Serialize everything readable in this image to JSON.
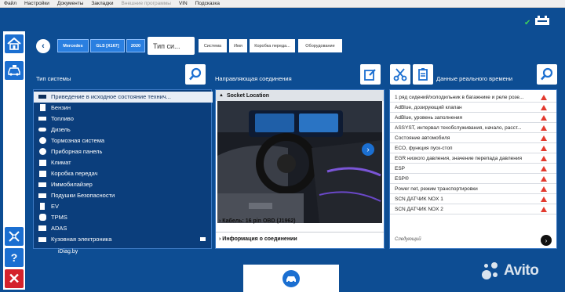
{
  "menu": {
    "items": [
      "Файл",
      "Настройки",
      "Документы",
      "Закладки",
      "Внешние программы",
      "VIN",
      "Подсказка"
    ],
    "disabled_index": 4
  },
  "breadcrumb": {
    "back_label": "‹",
    "crumbs": [
      "Mercedes",
      "GLS [X167]",
      "2020"
    ],
    "search_text": "Тип си...",
    "tabs": [
      "Система",
      "Имя",
      "Коробка переда...",
      "Оборудование"
    ]
  },
  "left_panel": {
    "title": "Тип системы",
    "items": [
      {
        "label": "Приведение в исходное состояние технич...",
        "icon": "reset-icon",
        "selected": true
      },
      {
        "label": "Бензин",
        "icon": "fuel-pump-icon",
        "selected": false
      },
      {
        "label": "Топливо",
        "icon": "fuel-gauge-icon",
        "selected": false
      },
      {
        "label": "Дизель",
        "icon": "diesel-icon",
        "selected": false
      },
      {
        "label": "Тормозная система",
        "icon": "brake-icon",
        "selected": false
      },
      {
        "label": "Приборная панель",
        "icon": "dashboard-icon",
        "selected": false
      },
      {
        "label": "Климат",
        "icon": "climate-icon",
        "selected": false
      },
      {
        "label": "Коробка передач",
        "icon": "gearbox-icon",
        "selected": false
      },
      {
        "label": "Иммобилайзер",
        "icon": "immobilizer-icon",
        "selected": false
      },
      {
        "label": "Подушки Безопасности",
        "icon": "airbag-icon",
        "selected": false
      },
      {
        "label": "EV",
        "icon": "ev-icon",
        "selected": false
      },
      {
        "label": "TPMS",
        "icon": "tpms-icon",
        "selected": false
      },
      {
        "label": "ADAS",
        "icon": "adas-icon",
        "selected": false
      },
      {
        "label": "Кузовная электроника",
        "icon": "body-electronics-icon",
        "selected": false
      }
    ],
    "footer": "iDiag.by"
  },
  "middle_panel": {
    "title": "Направляющая соединения",
    "socket_location": "Socket Location",
    "cable": "Кабель: 16 pin OBD (J1962)",
    "connection_info": "Информация о соединении"
  },
  "right_panel": {
    "title": "Данные реального времени",
    "items": [
      "1 ряд сидений/холодильник в багажнике и реле розе...",
      "AdBlue, дозирующий клапан",
      "AdBlue, уровень заполнения",
      "ASSYST, интервал техобслуживания, начало, расст...",
      "Состояние автомобиля",
      "ECO, функция пуск-стоп",
      "EGR низкого давления, значение перепада давления",
      "ESP",
      "ESP®",
      "Power net, режим транспортировки",
      "SCN ДАТЧИК NOX 1",
      "SCN ДАТЧИК NOX 2"
    ],
    "next_label": "Следующий"
  },
  "watermark": "Avito",
  "colors": {
    "background": "#0d4d93",
    "accent": "#1b6fd1",
    "warning": "#e23a2e",
    "ok": "#3fd05a"
  }
}
